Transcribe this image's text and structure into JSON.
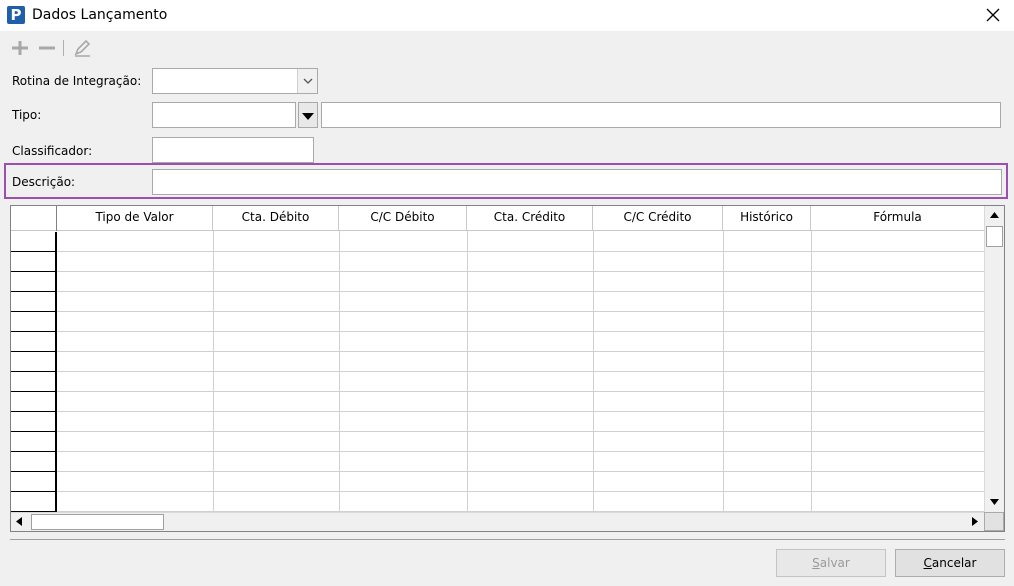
{
  "window": {
    "app_icon_letter": "P",
    "title": "Dados Lançamento"
  },
  "toolbar": {
    "add_icon": "plus-icon",
    "remove_icon": "minus-icon",
    "edit_icon": "pencil-icon"
  },
  "form": {
    "rotina_label": "Rotina de Integração:",
    "rotina_value": "",
    "tipo_label": "Tipo:",
    "tipo_code_value": "",
    "tipo_desc_value": "",
    "classificador_label": "Classificador:",
    "classificador_value": "",
    "descricao_label": "Descrição:",
    "descricao_value": ""
  },
  "grid": {
    "columns": [
      "Tipo de Valor",
      "Cta. Débito",
      "C/C Débito",
      "Cta. Crédito",
      "C/C Crédito",
      "Histórico",
      "Fórmula"
    ],
    "row_count": 14
  },
  "buttons": {
    "salvar_first": "S",
    "salvar_rest": "alvar",
    "cancelar_first": "C",
    "cancelar_rest": "ancelar"
  },
  "colors": {
    "highlight": "#9b4fae",
    "app_icon": "#1f5fa8"
  }
}
